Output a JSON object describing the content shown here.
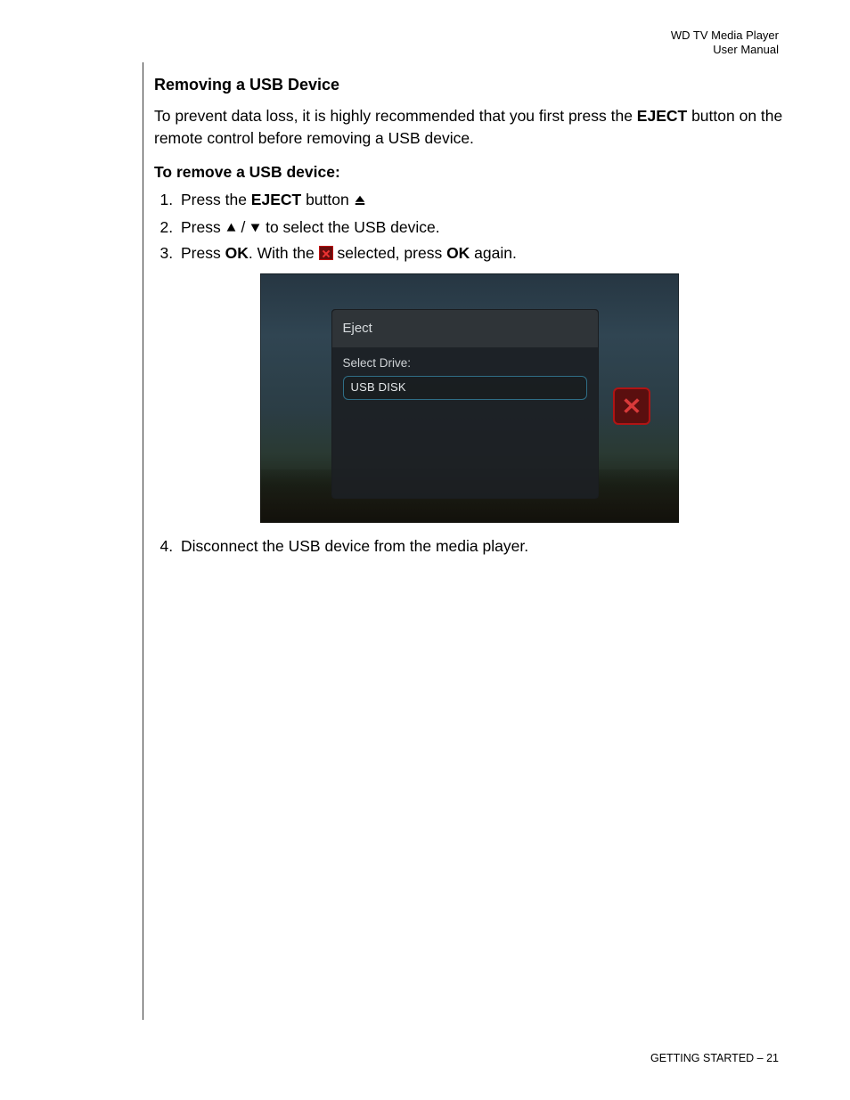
{
  "header": {
    "product": "WD TV Media Player",
    "doc": "User Manual"
  },
  "section": {
    "title": "Removing a USB Device",
    "intro_pre": "To prevent data loss, it is highly recommended that you first press the ",
    "intro_bold": "EJECT",
    "intro_post": " button on the remote control before removing a USB device.",
    "subhead": "To remove a USB device:",
    "steps": {
      "s1_pre": "Press the ",
      "s1_bold": "EJECT",
      "s1_post": " button ",
      "s2_pre": "Press ",
      "s2_mid": " / ",
      "s2_post": " to select the USB device.",
      "s3_pre": "Press ",
      "s3_b1": "OK",
      "s3_mid1": ". With the ",
      "s3_mid2": " selected, press ",
      "s3_b2": "OK",
      "s3_post": " again.",
      "s4": "Disconnect the USB device from the media player."
    }
  },
  "screenshot": {
    "dialog_title": "Eject",
    "select_label": "Select Drive:",
    "drive_value": "USB DISK",
    "close_glyph": "✕"
  },
  "footer": {
    "section": "GETTING STARTED",
    "sep": " – ",
    "page": "21"
  }
}
